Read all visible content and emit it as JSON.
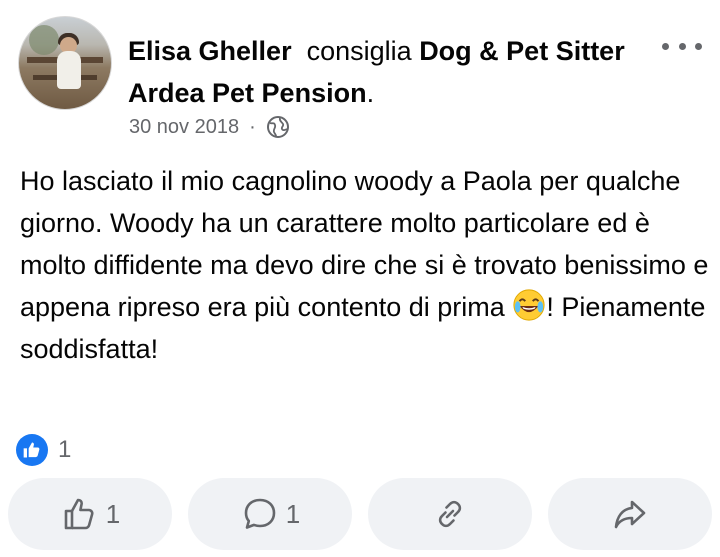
{
  "post": {
    "author": "Elisa Gheller",
    "verb": "consiglia",
    "page_name": "Dog & Pet Sitter Ardea Pet Pension",
    "period": ".",
    "date": "30 nov 2018",
    "separator": "·",
    "privacy_icon": "globe-icon",
    "more_icon": "more-options-icon",
    "text_part1": "Ho lasciato il mio cagnolino woody a Paola per qualche giorno. Woody ha un carattere molto particolare ed è molto diffidente ma devo dire che si è trovato benissimo e appena ripreso era più contento di prima ",
    "emoji": "face-with-tears-of-joy",
    "text_part2": "! Pienamente soddisfatta!"
  },
  "reactions": {
    "icon": "like-icon",
    "count": "1"
  },
  "actions": {
    "like": {
      "icon": "thumbs-up-icon",
      "count": "1"
    },
    "comment": {
      "icon": "comment-icon",
      "count": "1"
    },
    "link": {
      "icon": "link-icon"
    },
    "share": {
      "icon": "share-icon"
    }
  },
  "colors": {
    "text": "#050505",
    "secondary": "#65676b",
    "button_bg": "#f0f2f5",
    "like_blue": "#1877f2"
  }
}
